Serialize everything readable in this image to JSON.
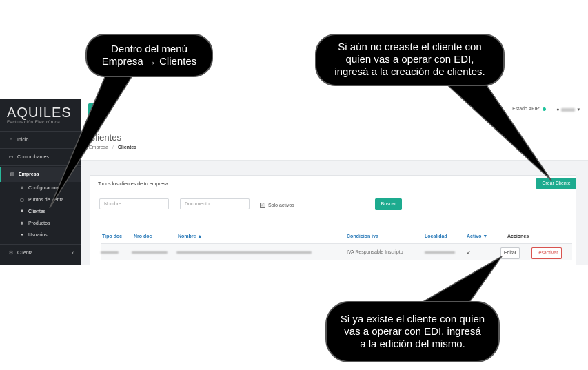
{
  "app": {
    "logo": "AQUILES",
    "logo_sub": "Facturación Electrónica"
  },
  "sidebar": {
    "items": [
      {
        "label": "Inicio",
        "icon": "home-icon"
      },
      {
        "label": "Comprobantes",
        "icon": "credit-card-icon"
      },
      {
        "label": "Empresa",
        "icon": "building-icon"
      },
      {
        "label": "Cuenta",
        "icon": "cogs-icon"
      }
    ],
    "sub_items": [
      {
        "label": "Configuracion",
        "icon": "gear-icon"
      },
      {
        "label": "Puntos de Venta",
        "icon": "store-icon"
      },
      {
        "label": "Clientes",
        "icon": "users-icon"
      },
      {
        "label": "Productos",
        "icon": "cubes-icon"
      },
      {
        "label": "Usuarios",
        "icon": "user-icon"
      }
    ],
    "cuenta_chevron": "‹"
  },
  "topbar": {
    "estado_label": "Estado AFIP:",
    "estado_color": "#1fc39c"
  },
  "page": {
    "title": "Clientes",
    "breadcrumb_parent": "Empresa",
    "breadcrumb_sep": "/",
    "breadcrumb_current": "Clientes"
  },
  "card": {
    "title": "Todos los clientes de tu empresa",
    "create_button": "Crear Cliente",
    "filters": {
      "nombre_placeholder": "Nombre",
      "documento_placeholder": "Documento",
      "solo_activos_label": "Solo activos",
      "solo_activos_checked": true,
      "search_button": "Buscar"
    }
  },
  "table": {
    "columns": [
      "Tipo doc",
      "Nro doc",
      "Nombre ▲",
      "Condicion iva",
      "Localidad",
      "Activo ▼",
      "Acciones"
    ],
    "rows": [
      {
        "condicion_iva": "IVA Responsable Inscripto",
        "activo": "✔",
        "edit_label": "Editar",
        "deactivate_label": "Desactivar"
      }
    ]
  },
  "annotations": {
    "menu": "Dentro del menú\nEmpresa → Clientes",
    "create": "Si aún no creaste el cliente con\nquien vas a operar con EDI,\ningresá a la creación de clientes.",
    "edit": "Si ya existe el cliente con quien\nvas a operar con EDI, ingresá\na la edición del mismo."
  },
  "colors": {
    "accent": "#1dab8f",
    "sidebar_bg": "#1f2227",
    "link": "#2a7ab8",
    "danger": "#d9534f"
  }
}
